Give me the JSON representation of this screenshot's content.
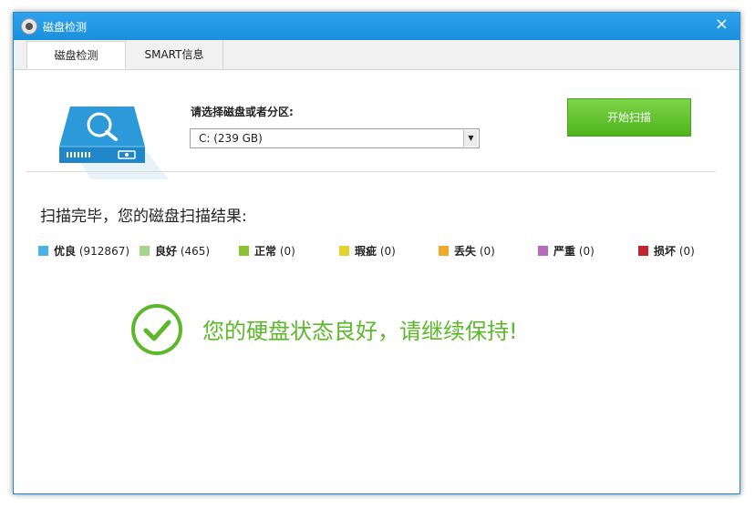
{
  "window": {
    "title": "磁盘检测",
    "close_glyph": "×"
  },
  "tabs": [
    {
      "label": "磁盘检测",
      "active": true
    },
    {
      "label": "SMART信息",
      "active": false
    }
  ],
  "disk_select": {
    "label": "请选择磁盘或者分区:",
    "value": "C:  (239 GB)",
    "arrow_glyph": "▼"
  },
  "start_button": {
    "label": "开始扫描",
    "color": "#5cc22a"
  },
  "results": {
    "title": "扫描完毕，您的磁盘扫描结果:",
    "legend": [
      {
        "name": "优良",
        "count": "(912867)",
        "color": "#4ab3e8"
      },
      {
        "name": "良好",
        "count": "(465)",
        "color": "#a6d48a"
      },
      {
        "name": "正常",
        "count": "(0)",
        "color": "#8bc233"
      },
      {
        "name": "瑕疵",
        "count": "(0)",
        "color": "#e6d12c"
      },
      {
        "name": "丢失",
        "count": "(0)",
        "color": "#f0a92a"
      },
      {
        "name": "严重",
        "count": "(0)",
        "color": "#b66bbf"
      },
      {
        "name": "损坏",
        "count": "(0)",
        "color": "#c4222b"
      }
    ]
  },
  "status": {
    "message": "您的硬盘状态良好，请继续保持!",
    "icon": "check-circle-icon",
    "color": "#5cb82a"
  },
  "colors": {
    "titlebar": "#1a8fdc",
    "accent": "#2ea3ec"
  }
}
